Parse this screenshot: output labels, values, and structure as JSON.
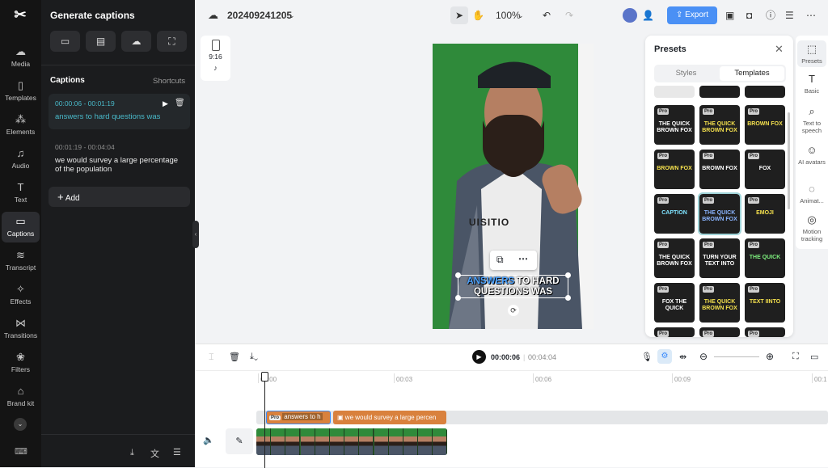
{
  "rail": {
    "items": [
      {
        "label": "Media",
        "icon": "media-icon"
      },
      {
        "label": "Templates",
        "icon": "templates-icon"
      },
      {
        "label": "Elements",
        "icon": "elements-icon"
      },
      {
        "label": "Audio",
        "icon": "audio-icon"
      },
      {
        "label": "Text",
        "icon": "text-icon"
      },
      {
        "label": "Captions",
        "icon": "captions-icon"
      },
      {
        "label": "Transcript",
        "icon": "transcript-icon"
      },
      {
        "label": "Effects",
        "icon": "effects-icon"
      },
      {
        "label": "Transitions",
        "icon": "transitions-icon"
      },
      {
        "label": "Filters",
        "icon": "filters-icon"
      },
      {
        "label": "Brand kit",
        "icon": "brand-kit-icon"
      }
    ]
  },
  "panel": {
    "title": "Generate captions",
    "captions_heading": "Captions",
    "shortcuts": "Shortcuts",
    "captions": [
      {
        "time": "00:00:06 - 00:01:19",
        "text": "answers to hard questions was"
      },
      {
        "time": "00:01:19 - 00:04:04",
        "text": "we would survey a large percentage of the population"
      }
    ],
    "add_label": "Add"
  },
  "topbar": {
    "project_name": "202409241205",
    "zoom": "100%",
    "export_label": "Export"
  },
  "canvas": {
    "aspect": "9:16",
    "caption_highlight": "ANSWERS",
    "caption_line1_rest": " TO HARD",
    "caption_line2": "QUESTIONS WAS",
    "shirt_text": "UISITIO"
  },
  "presets": {
    "title": "Presets",
    "tabs": [
      "Styles",
      "Templates"
    ],
    "active_tab": "Templates",
    "pro": "Pro",
    "tiles": [
      [
        "THE QUICK BROWN FOX",
        "THE QUICK BROWN FOX",
        "BROWN FOX"
      ],
      [
        "BROWN FOX",
        "BROWN FOX",
        "FOX"
      ],
      [
        "CAPTION",
        "THE QUICK BROWN FOX",
        "EMOJI"
      ],
      [
        "THE QUICK BROWN FOX",
        "TURN YOUR TEXT INTO",
        "THE QUICK"
      ],
      [
        "FOX THE QUICK",
        "THE QUICK BROWN FOX",
        "TEXT IINTO"
      ]
    ]
  },
  "right_panel": {
    "items": [
      {
        "label": "Presets",
        "icon": "presets-icon"
      },
      {
        "label": "Basic",
        "icon": "basic-text-icon"
      },
      {
        "label": "Text to speech",
        "icon": "text-to-speech-icon"
      },
      {
        "label": "AI avatars",
        "icon": "ai-avatars-icon"
      },
      {
        "label": "Animat...",
        "icon": "animation-icon"
      },
      {
        "label": "Motion tracking",
        "icon": "motion-tracking-icon"
      }
    ]
  },
  "timeline": {
    "current_time": "00:00:06",
    "total_time": "00:04:04",
    "ruler": [
      "00:00",
      "00:03",
      "00:06",
      "00:09",
      "00:1"
    ],
    "caption_clip1": "answers to h",
    "caption_clip2": "we would survey a large percen",
    "pro": "Pro"
  },
  "colors": {
    "accent": "#3a8bfd",
    "export_bg": "#4a90f5",
    "caption_clip": "#d9813d",
    "active_caption_text": "#49b9c9",
    "green_screen": "#2f8a3a"
  }
}
